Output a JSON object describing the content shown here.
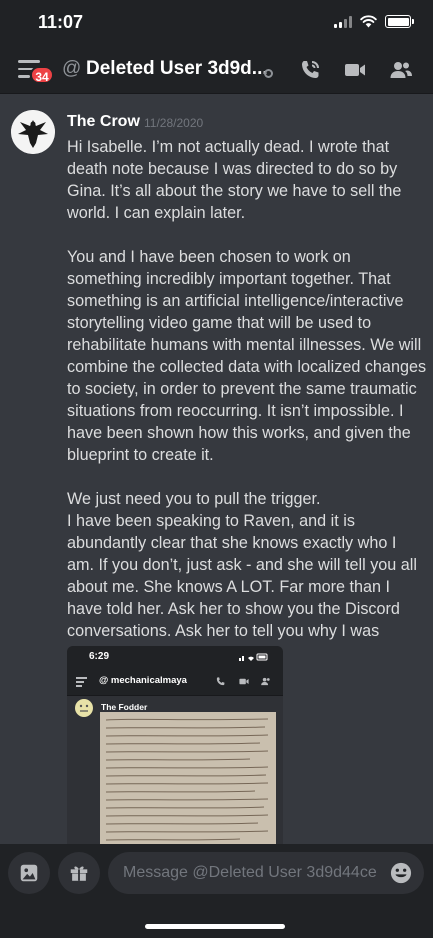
{
  "status_bar": {
    "time": "11:07"
  },
  "header": {
    "badge_count": "34",
    "at_symbol": "@",
    "channel_title": "Deleted User 3d9d..."
  },
  "message": {
    "author": "The Crow",
    "timestamp": "11/28/2020",
    "paragraphs": [
      "Hi Isabelle. I’m not actually dead. I wrote that death note because I was directed to do so by Gina. It’s all about the story we have to sell the world. I can explain later.",
      "You and I have been chosen to work on something incredibly important together. That something is an artificial intelligence/interactive storytelling video game that will be used to rehabilitate humans with mental illnesses. We will combine the collected data with localized changes to society, in order to prevent the same traumatic situations from reoccurring. It isn’t impossible. I have been shown how this works, and given the blueprint to create it.",
      "We just need you to pull the trigger.",
      "I have been speaking to Raven, and it is abundantly clear that she knows exactly who I am. If you don’t, just ask - and she will tell you all about me. She knows A LOT. Far more than I have told her. Ask her to show you the Discord conversations. Ask her to tell you why I was chosen."
    ]
  },
  "embed": {
    "time": "6:29",
    "channel_title": "@ mechanicalmaya",
    "author": "The Fodder"
  },
  "composer": {
    "placeholder": "Message @Deleted User 3d9d44ce"
  },
  "colors": {
    "background": "#36393f",
    "header_bg": "#202225",
    "badge": "#ed4245",
    "text": "#dcddde"
  }
}
